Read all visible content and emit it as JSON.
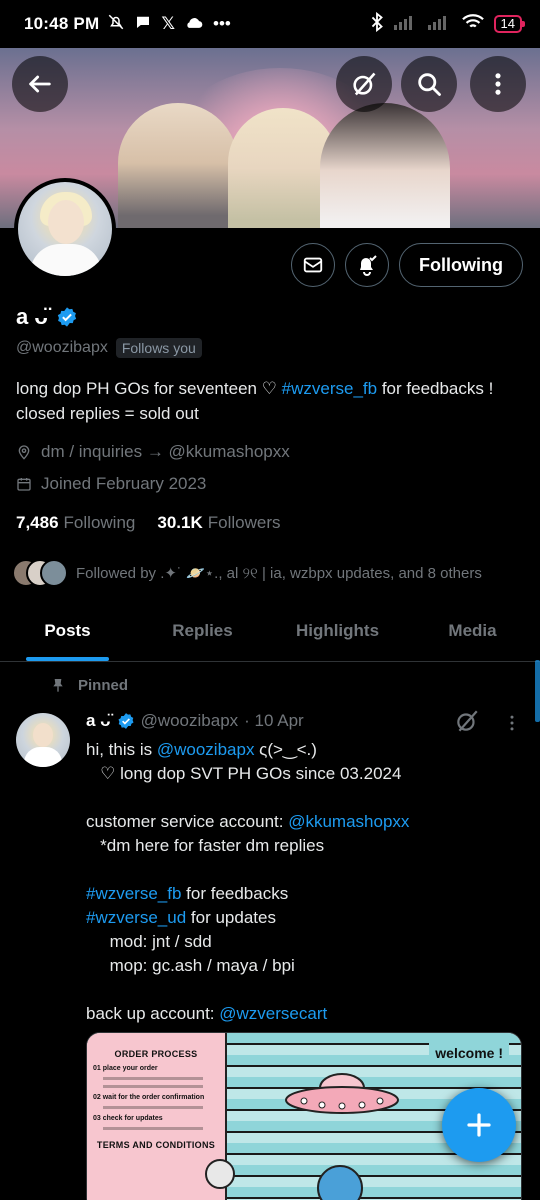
{
  "status_bar": {
    "time": "10:48 PM",
    "left_icons": [
      "mute-bell-icon",
      "chat-icon",
      "x-logo-icon",
      "cloud-icon",
      "more-dots-icon"
    ],
    "battery": "14"
  },
  "profile": {
    "name": "a ᴗ̈",
    "handle": "@woozibapx",
    "follows_you": "Follows you",
    "follow_button": "Following",
    "bio_parts": {
      "part1": "long dop PH GOs for seventeen ♡ ",
      "hashtag": "#wzverse_fb",
      "part2": " for feedbacks !",
      "line2": "closed replies = sold out"
    },
    "location_text": "dm / inquiries → ",
    "location_mention": "@kkumashopxx",
    "joined": "Joined February 2023",
    "following_count": "7,486",
    "following_label": "Following",
    "followers_count": "30.1K",
    "followers_label": "Followers",
    "followed_by": "Followed by .✦˙ 🪐⋆., al ୨୧ | ia, wzbpx updates, and 8 others"
  },
  "tabs": [
    "Posts",
    "Replies",
    "Highlights",
    "Media"
  ],
  "active_tab": "Posts",
  "tweet": {
    "pinned_label": "Pinned",
    "name": "a ᴗ̈",
    "handle": "@woozibapx",
    "date": "· 10 Apr",
    "lines": {
      "l1a": "hi, this is ",
      "l1m": "@woozibapx",
      "l1b": " ς(>‿<.)",
      "l2": "   ♡ long dop SVT PH GOs since 03.2024",
      "l3a": "customer service account: ",
      "l3m": "@kkumashopxx",
      "l4": "   *dm here for faster dm replies",
      "l5h": "#wzverse_fb",
      "l5b": " for feedbacks",
      "l6h": "#wzverse_ud",
      "l6b": " for updates",
      "l7": "     mod: jnt / sdd",
      "l8": "     mop: gc.ash / maya / bpi",
      "l9a": "back up account: ",
      "l9m": "@wzversecart"
    },
    "media": {
      "title": "ORDER PROCESS",
      "steps": [
        "01  place your order",
        "02  wait for the order confirmation",
        "03  check for updates"
      ],
      "terms": "TERMS AND CONDITIONS",
      "welcome": "welcome !"
    }
  },
  "colors": {
    "accent": "#1d9bf0",
    "background": "#000000",
    "muted": "#71767b",
    "battery_low": "#e0245e"
  }
}
